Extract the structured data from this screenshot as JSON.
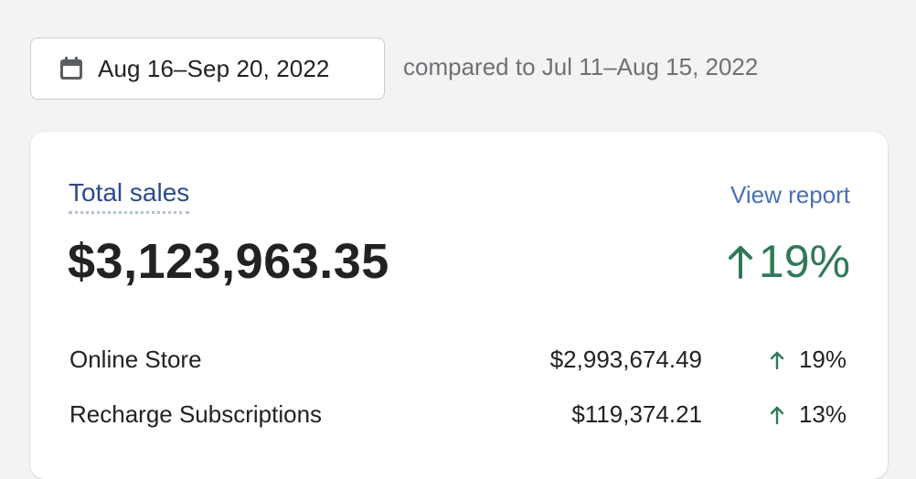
{
  "date_range": {
    "label": "Aug 16–Sep 20, 2022",
    "comparison": "compared to Jul 11–Aug 15, 2022"
  },
  "card": {
    "title": "Total sales",
    "view_report": "View report",
    "total_value": "$3,123,963.35",
    "total_change": "19%",
    "rows": [
      {
        "name": "Online Store",
        "amount": "$2,993,674.49",
        "change": "19%"
      },
      {
        "name": "Recharge Subscriptions",
        "amount": "$119,374.21",
        "change": "13%"
      }
    ]
  },
  "colors": {
    "accent_link": "#4a6fb5",
    "title": "#2c4a8c",
    "positive": "#2f7a56",
    "background": "#f3f3f3"
  },
  "icons": {
    "date_button": "calendar-icon",
    "change": "arrow-up-icon"
  }
}
